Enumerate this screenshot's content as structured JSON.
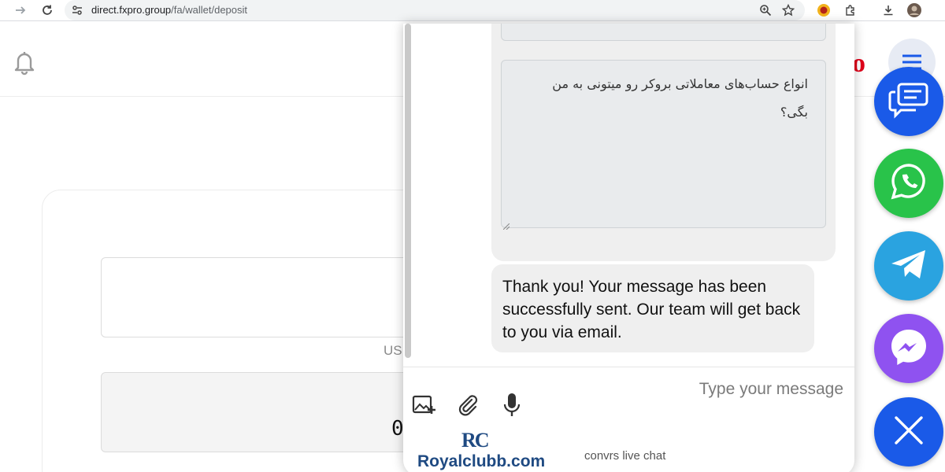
{
  "browser": {
    "url_host": "direct.fxpro.group",
    "url_path": "/fa/wallet/deposit"
  },
  "site": {
    "brand_letter": "o",
    "field_label": "US",
    "amount_value": "0"
  },
  "chat": {
    "question_text": "انواع حساب‌های معاملاتی بروکر رو میتونی به من بگی؟",
    "reply_text": "Thank you! Your message has been successfully sent. Our team will get back to you via email.",
    "input_placeholder": "Type your message",
    "powered_by": "convrs live chat",
    "brand_mark": "RC",
    "brand_name": "Royalclubb.com"
  },
  "floating_buttons": [
    {
      "name": "live-chat",
      "icon": "chat-bubbles-icon",
      "color": "#1a5ae8"
    },
    {
      "name": "whatsapp",
      "icon": "whatsapp-icon",
      "color": "#29c34a"
    },
    {
      "name": "telegram",
      "icon": "telegram-icon",
      "color": "#2aa3e0"
    },
    {
      "name": "messenger",
      "icon": "messenger-icon",
      "color": "#8f52f0"
    },
    {
      "name": "close",
      "icon": "close-icon",
      "color": "#1a5ae8"
    }
  ]
}
